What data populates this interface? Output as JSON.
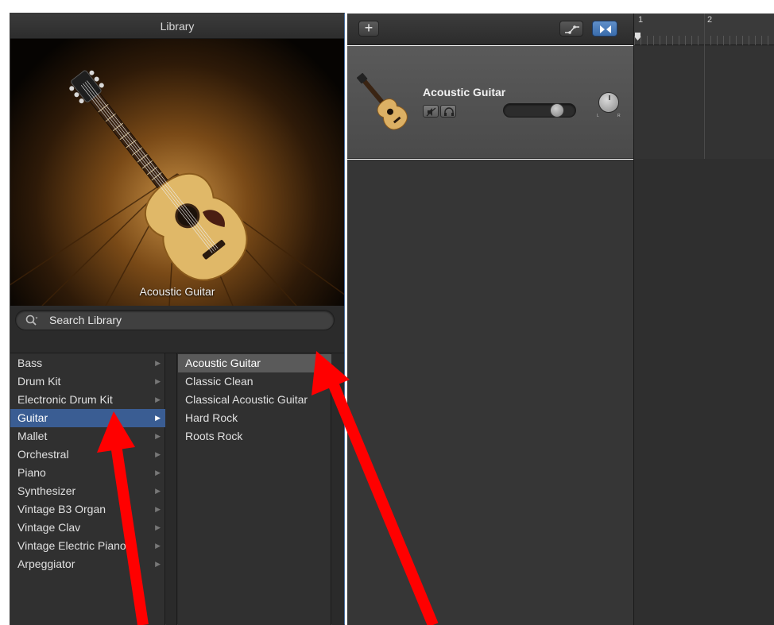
{
  "library": {
    "title": "Library",
    "image_caption": "Acoustic Guitar",
    "search_placeholder": "Search Library",
    "categories": [
      {
        "label": "Bass"
      },
      {
        "label": "Drum Kit"
      },
      {
        "label": "Electronic Drum Kit"
      },
      {
        "label": "Guitar",
        "selected": true
      },
      {
        "label": "Mallet"
      },
      {
        "label": "Orchestral"
      },
      {
        "label": "Piano"
      },
      {
        "label": "Synthesizer"
      },
      {
        "label": "Vintage B3 Organ"
      },
      {
        "label": "Vintage Clav"
      },
      {
        "label": "Vintage Electric Piano"
      },
      {
        "label": "Arpeggiator"
      }
    ],
    "patches": [
      {
        "label": "Acoustic Guitar",
        "selected": true
      },
      {
        "label": "Classic Clean"
      },
      {
        "label": "Classical Acoustic Guitar"
      },
      {
        "label": "Hard Rock"
      },
      {
        "label": "Roots Rock"
      }
    ]
  },
  "track": {
    "name": "Acoustic Guitar",
    "pan_left": "L",
    "pan_right": "R",
    "volume_level": 0.8
  },
  "timeline": {
    "bars": [
      "1",
      "2"
    ]
  },
  "colors": {
    "selection": "#3a5d93",
    "annotation_arrow": "#ff0000"
  }
}
